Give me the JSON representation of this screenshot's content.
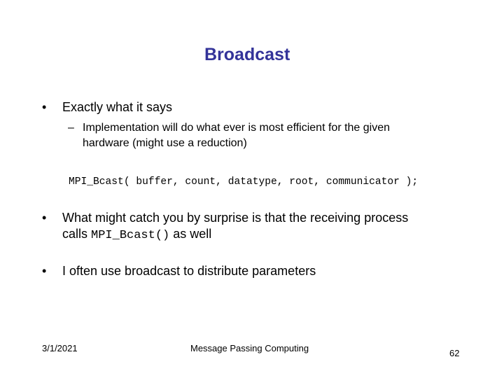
{
  "slide": {
    "title": "Broadcast",
    "bullets": [
      {
        "marker": "•",
        "text": "Exactly what it says",
        "sub": [
          {
            "marker": "–",
            "line1": "Implementation will do what ever is most efficient for the given",
            "line2": "hardware (might use a reduction)"
          }
        ]
      },
      {
        "marker": "•",
        "line1": "What might catch you by surprise is that the receiving process",
        "line2_pre": "calls ",
        "line2_code": "MPI_Bcast()",
        "line2_post": " as well"
      },
      {
        "marker": "•",
        "text": "I often use broadcast to distribute parameters"
      }
    ],
    "code": "MPI_Bcast( buffer, count, datatype, root, communicator );"
  },
  "footer": {
    "date": "3/1/2021",
    "center": "Message Passing Computing",
    "page": "62"
  },
  "colors": {
    "title": "#333399",
    "text": "#000000",
    "background": "#ffffff"
  }
}
